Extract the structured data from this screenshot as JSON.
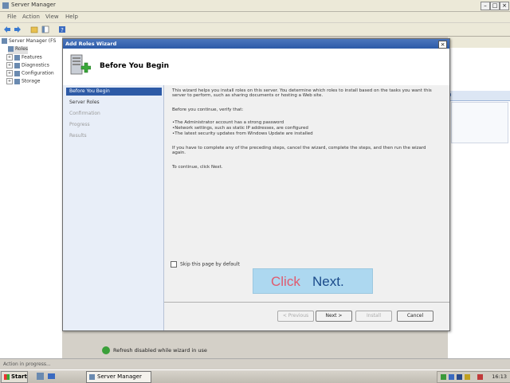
{
  "outer_window": {
    "title": "Server Manager",
    "menu": [
      "File",
      "Action",
      "View",
      "Help"
    ],
    "tree": [
      {
        "label": "Server Manager (FS",
        "expander": ""
      },
      {
        "label": "Roles",
        "expander": ""
      },
      {
        "label": "Features",
        "expander": "+"
      },
      {
        "label": "Diagnostics",
        "expander": "+"
      },
      {
        "label": "Configuration",
        "expander": "+"
      },
      {
        "label": "Storage",
        "expander": "+"
      }
    ],
    "right_pane_link": "p",
    "refresh_text": "Refresh disabled while wizard in use",
    "status_text": "Action in progress..."
  },
  "wizard": {
    "title": "Add Roles Wizard",
    "close": "×",
    "heading": "Before You Begin",
    "nav": [
      "Before You Begin",
      "Server Roles",
      "Confirmation",
      "Progress",
      "Results"
    ],
    "content": {
      "intro": "This wizard helps you install roles on this server. You determine which roles to install based on the tasks you want this server to perform, such as sharing documents or hosting a Web site.",
      "verify": "Before you continue, verify that:",
      "bullets": [
        "The Administrator account has a strong password",
        "Network settings, such as static IP addresses, are configured",
        "The latest security updates from Windows Update are installed"
      ],
      "if_text": "If you have to complete any of the preceding steps, cancel the wizard, complete the steps, and then run the wizard again.",
      "continue": "To continue, click Next.",
      "skip_label": "Skip this page by default"
    },
    "callout": {
      "part1": "Click",
      "part2": "Next."
    },
    "buttons": {
      "previous": "< Previous",
      "next": "Next >",
      "install": "Install",
      "cancel": "Cancel"
    }
  },
  "taskbar": {
    "start": "Start",
    "task": "Server Manager",
    "clock": "16:13"
  },
  "colors": {
    "title_bar": "#2c5aa8",
    "nav_selected": "#2d5aa6",
    "callout_bg": "#add8f0"
  }
}
